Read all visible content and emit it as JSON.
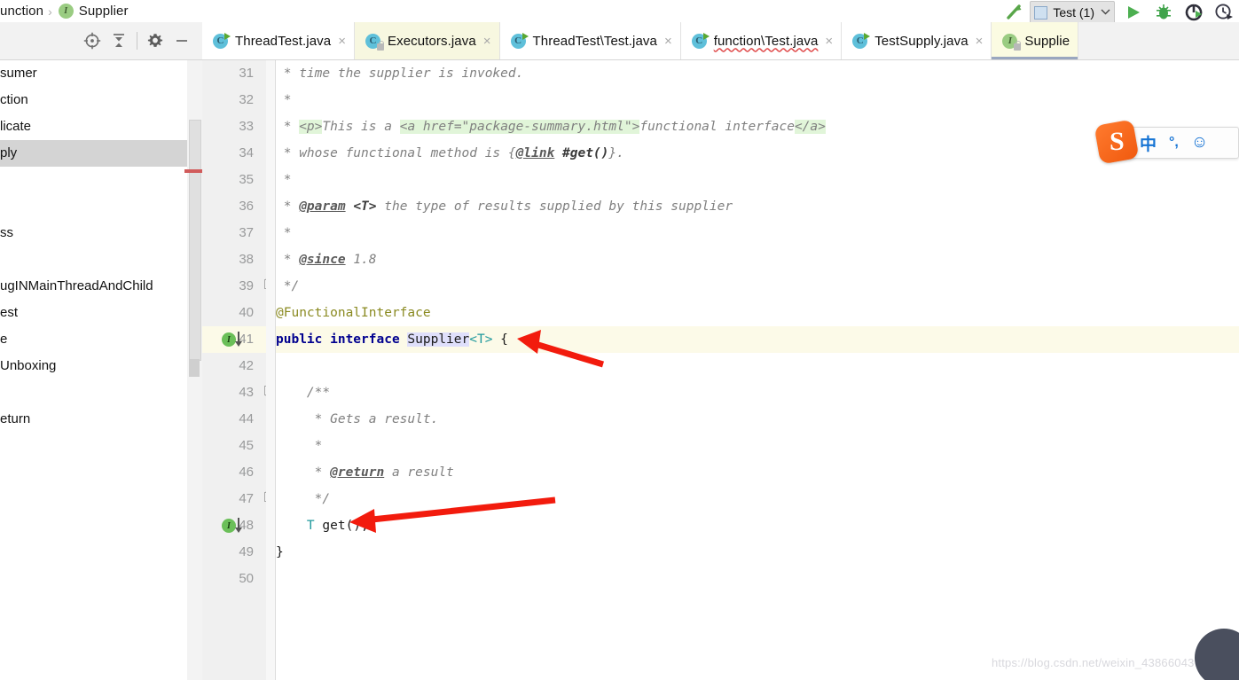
{
  "breadcrumb": {
    "package_fragment": "unction",
    "separator": "›",
    "current": "Supplier",
    "iface_letter": "I"
  },
  "run_toolbar": {
    "build_icon": "hammer-icon",
    "config_label": "Test (1)",
    "caret": "⌄",
    "run_icon": "run-icon",
    "debug_icon": "debug-icon",
    "run_coverage_icon": "run-with-coverage-icon",
    "profile_icon": "profiler-icon"
  },
  "left_panel": {
    "toolbar_icons": [
      "locate-target-icon",
      "collapse-all-icon",
      "settings-gear-icon",
      "hide-panel-icon"
    ],
    "tree_items": [
      {
        "label": "sumer",
        "selected": false
      },
      {
        "label": "ction",
        "selected": false
      },
      {
        "label": "licate",
        "selected": false
      },
      {
        "label": "ply",
        "selected": true
      },
      {
        "label": "",
        "selected": false
      },
      {
        "label": "",
        "selected": false
      },
      {
        "label": "ss",
        "selected": false
      },
      {
        "label": "",
        "selected": false
      },
      {
        "label": "ugINMainThreadAndChild",
        "selected": false
      },
      {
        "label": "est",
        "selected": false
      },
      {
        "label": "e",
        "selected": false
      },
      {
        "label": "Unboxing",
        "selected": false
      },
      {
        "label": "",
        "selected": false
      },
      {
        "label": "eturn",
        "selected": false
      }
    ]
  },
  "tabs": [
    {
      "label": "ThreadTest.java",
      "icon": "java-class-runnable-icon",
      "state": "normal",
      "error": false,
      "locked": false
    },
    {
      "label": "Executors.java",
      "icon": "java-class-readonly-icon",
      "state": "yellow",
      "error": false,
      "locked": true
    },
    {
      "label": "ThreadTest\\Test.java",
      "icon": "java-class-runnable-icon",
      "state": "normal",
      "error": false,
      "locked": false
    },
    {
      "label": "function\\Test.java",
      "icon": "java-class-runnable-icon",
      "state": "normal",
      "error": true,
      "locked": false
    },
    {
      "label": "TestSupply.java",
      "icon": "java-class-runnable-icon",
      "state": "normal",
      "error": false,
      "locked": false
    },
    {
      "label": "Supplie",
      "icon": "java-interface-readonly-icon",
      "state": "active",
      "error": false,
      "locked": true
    }
  ],
  "tab_close_glyph": "×",
  "editor": {
    "file": "Supplier.java",
    "first_line": 31,
    "highlighted_line": 41,
    "lines": [
      {
        "n": 31,
        "tokens": [
          {
            "t": " * time the supplier is invoked.",
            "c": "cm"
          }
        ]
      },
      {
        "n": 32,
        "tokens": [
          {
            "t": " *",
            "c": "cm"
          }
        ]
      },
      {
        "n": 33,
        "tokens": [
          {
            "t": " * ",
            "c": "cm"
          },
          {
            "t": "<p>",
            "c": "cm-tag"
          },
          {
            "t": "This is a ",
            "c": "cm"
          },
          {
            "t": "<a href=\"package-summary.html\">",
            "c": "cm-tag"
          },
          {
            "t": "functional interface",
            "c": "cm"
          },
          {
            "t": "</a>",
            "c": "cm-tag"
          }
        ]
      },
      {
        "n": 34,
        "tokens": [
          {
            "t": " * whose functional method is {",
            "c": "cm"
          },
          {
            "t": "@link",
            "c": "cm-link"
          },
          {
            "t": " ",
            "c": "cm"
          },
          {
            "t": "#get()",
            "c": "cm-bold"
          },
          {
            "t": "}.",
            "c": "cm"
          }
        ]
      },
      {
        "n": 35,
        "tokens": [
          {
            "t": " *",
            "c": "cm"
          }
        ]
      },
      {
        "n": 36,
        "tokens": [
          {
            "t": " * ",
            "c": "cm"
          },
          {
            "t": "@param",
            "c": "cm-link"
          },
          {
            "t": " ",
            "c": "cm"
          },
          {
            "t": "<T>",
            "c": "cm-bold"
          },
          {
            "t": " the type of results supplied by this supplier",
            "c": "cm"
          }
        ]
      },
      {
        "n": 37,
        "tokens": [
          {
            "t": " *",
            "c": "cm"
          }
        ]
      },
      {
        "n": 38,
        "tokens": [
          {
            "t": " * ",
            "c": "cm"
          },
          {
            "t": "@since",
            "c": "cm-link"
          },
          {
            "t": " 1.8",
            "c": "cm"
          }
        ]
      },
      {
        "n": 39,
        "tokens": [
          {
            "t": " */",
            "c": "cm"
          }
        ],
        "fold": "end"
      },
      {
        "n": 40,
        "tokens": [
          {
            "t": "@FunctionalInterface",
            "c": "anno"
          }
        ]
      },
      {
        "n": 41,
        "tokens": [
          {
            "t": "public interface ",
            "c": "kw"
          },
          {
            "t": "Supplier",
            "c": "cls"
          },
          {
            "t": "<T>",
            "c": "gen"
          },
          {
            "t": " {",
            "c": "plain"
          }
        ],
        "hl": true,
        "marker": "impl"
      },
      {
        "n": 42,
        "tokens": []
      },
      {
        "n": 43,
        "tokens": [
          {
            "t": "    /**",
            "c": "cm"
          }
        ],
        "fold": "start"
      },
      {
        "n": 44,
        "tokens": [
          {
            "t": "     * Gets a result.",
            "c": "cm"
          }
        ]
      },
      {
        "n": 45,
        "tokens": [
          {
            "t": "     *",
            "c": "cm"
          }
        ]
      },
      {
        "n": 46,
        "tokens": [
          {
            "t": "     * ",
            "c": "cm"
          },
          {
            "t": "@return",
            "c": "cm-link"
          },
          {
            "t": " a result",
            "c": "cm"
          }
        ]
      },
      {
        "n": 47,
        "tokens": [
          {
            "t": "     */",
            "c": "cm"
          }
        ],
        "fold": "end"
      },
      {
        "n": 48,
        "tokens": [
          {
            "t": "    T",
            "c": "typ"
          },
          {
            "t": " get();",
            "c": "plain"
          }
        ],
        "marker": "impl"
      },
      {
        "n": 49,
        "tokens": [
          {
            "t": "}",
            "c": "plain"
          }
        ]
      },
      {
        "n": 50,
        "tokens": []
      }
    ]
  },
  "annotations": {
    "arrow_1_target": "public interface Supplier<T> {",
    "arrow_2_target": "T get();",
    "color": "#f21b0d"
  },
  "ime": {
    "logo_letter": "S",
    "mode": "中",
    "punctuation": "°,",
    "emoji": "☺"
  },
  "watermark": {
    "text": "https://blog.csdn.net/weixin_43866043"
  }
}
